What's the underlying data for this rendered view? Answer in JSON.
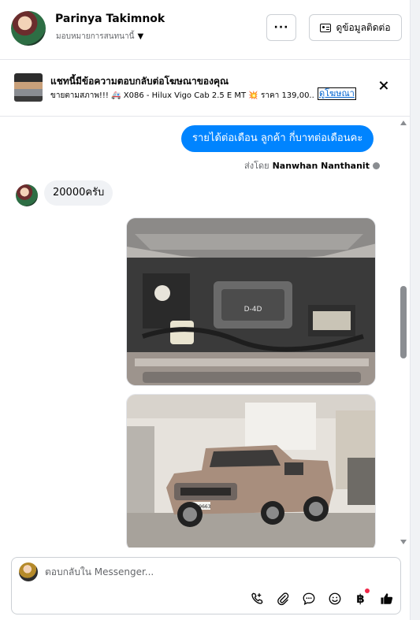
{
  "header": {
    "name": "Parinya Takimnok",
    "assign_label": "มอบหมายการสนทนานี้",
    "more_label": "···",
    "contact_button": "ดูข้อมูลติดต่อ"
  },
  "ad_banner": {
    "title": "แชทนี้มีข้อความตอบกลับต่อโฆษณาของคุณ",
    "description": "ขายตามสภาพ!!! 🚑 X086 - Hilux Vigo Cab 2.5 E MT 💥 ราคา 139,00...",
    "link_label": "ดูโฆษณา"
  },
  "messages": {
    "outgoing_text": "รายได้ต่อเดือน ลูกค้า กี่บาทต่อเดือนคะ",
    "sent_by_prefix": "ส่งโดย",
    "sent_by_name": "Nanwhan Nanthanit",
    "incoming_text": "20000ครับ",
    "photo1_label": "D-4D",
    "photo2_plate": "ฆจ 9663"
  },
  "composer": {
    "placeholder": "ตอบกลับใน Messenger...",
    "currency_symbol": "฿"
  },
  "colors": {
    "accent": "#0084ff",
    "incoming_bubble": "#f0f2f5",
    "link": "#0064d1",
    "notification": "#f02849"
  }
}
